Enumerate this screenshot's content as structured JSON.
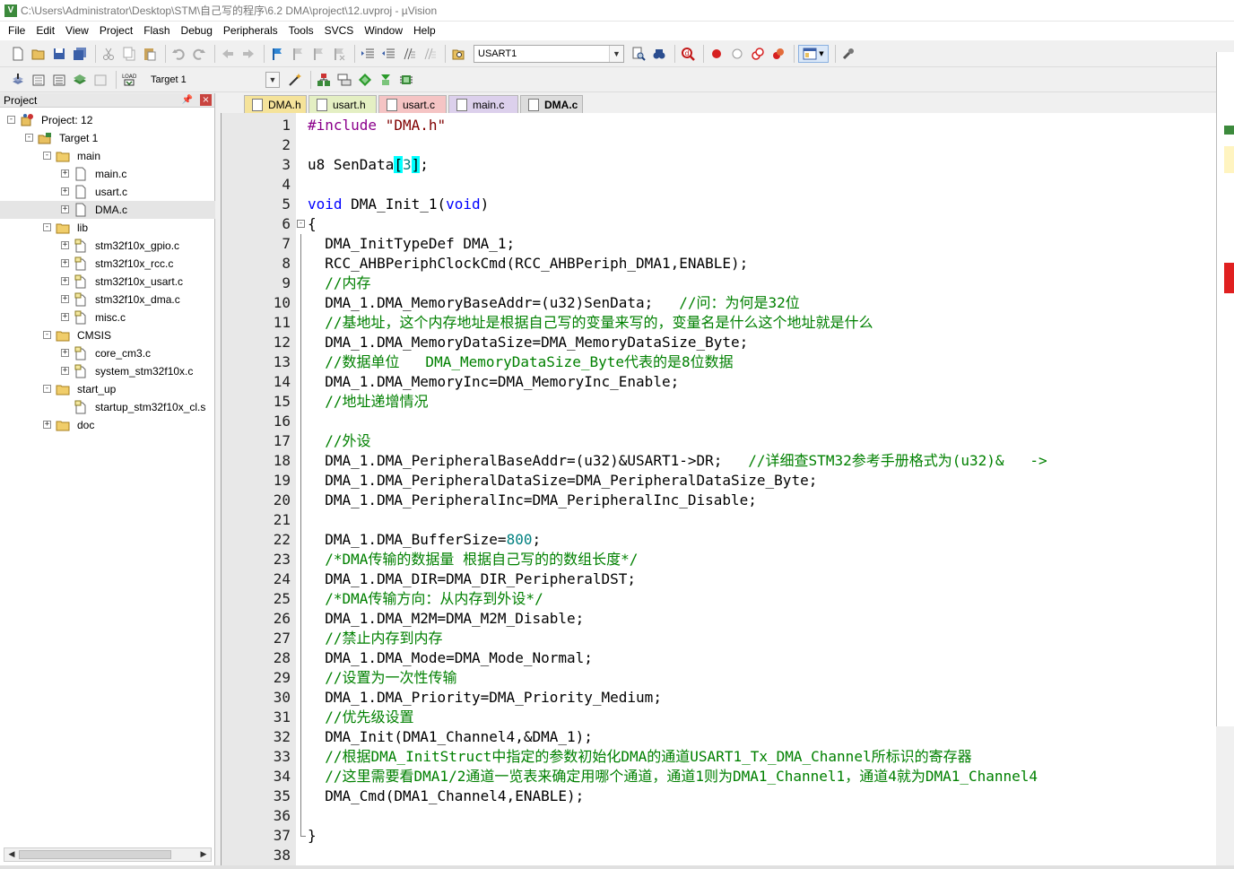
{
  "window": {
    "title": "C:\\Users\\Administrator\\Desktop\\STM\\自己写的程序\\6.2  DMA\\project\\12.uvproj - µVision"
  },
  "menu": [
    "File",
    "Edit",
    "View",
    "Project",
    "Flash",
    "Debug",
    "Peripherals",
    "Tools",
    "SVCS",
    "Window",
    "Help"
  ],
  "toolbar": {
    "search_combo": "USART1",
    "target_combo": "Target 1"
  },
  "project_panel": {
    "title": "Project",
    "tree": [
      {
        "label": "Project: 12",
        "level": 0,
        "type": "project",
        "expander": "−"
      },
      {
        "label": "Target 1",
        "level": 1,
        "type": "target",
        "expander": "−"
      },
      {
        "label": "main",
        "level": 2,
        "type": "folder",
        "expander": "−"
      },
      {
        "label": "main.c",
        "level": 3,
        "type": "file",
        "expander": "+"
      },
      {
        "label": "usart.c",
        "level": 3,
        "type": "file",
        "expander": "+"
      },
      {
        "label": "DMA.c",
        "level": 3,
        "type": "file",
        "expander": "+",
        "selected": true
      },
      {
        "label": "lib",
        "level": 2,
        "type": "folder",
        "expander": "−"
      },
      {
        "label": "stm32f10x_gpio.c",
        "level": 3,
        "type": "libfile",
        "expander": "+"
      },
      {
        "label": "stm32f10x_rcc.c",
        "level": 3,
        "type": "libfile",
        "expander": "+"
      },
      {
        "label": "stm32f10x_usart.c",
        "level": 3,
        "type": "libfile",
        "expander": "+"
      },
      {
        "label": "stm32f10x_dma.c",
        "level": 3,
        "type": "libfile",
        "expander": "+"
      },
      {
        "label": "misc.c",
        "level": 3,
        "type": "libfile",
        "expander": "+"
      },
      {
        "label": "CMSIS",
        "level": 2,
        "type": "folder",
        "expander": "−"
      },
      {
        "label": "core_cm3.c",
        "level": 3,
        "type": "libfile",
        "expander": "+"
      },
      {
        "label": "system_stm32f10x.c",
        "level": 3,
        "type": "libfile",
        "expander": "+"
      },
      {
        "label": "start_up",
        "level": 2,
        "type": "folder",
        "expander": "−"
      },
      {
        "label": "startup_stm32f10x_cl.s",
        "level": 3,
        "type": "libfile",
        "expander": ""
      },
      {
        "label": "doc",
        "level": 2,
        "type": "folder",
        "expander": "+"
      }
    ]
  },
  "tabs": [
    {
      "label": "DMA.h",
      "color": "#f5e39a",
      "active": false
    },
    {
      "label": "usart.h",
      "color": "#e4efc3",
      "active": false
    },
    {
      "label": "usart.c",
      "color": "#f5c4c4",
      "active": false
    },
    {
      "label": "main.c",
      "color": "#dcd0ec",
      "active": false
    },
    {
      "label": "DMA.c",
      "color": "#dcdcdc",
      "active": true
    }
  ],
  "editor": {
    "lines": [
      {
        "n": "1",
        "parts": [
          [
            "pp",
            "#include "
          ],
          [
            "str",
            "\"DMA.h\""
          ]
        ]
      },
      {
        "n": "2",
        "parts": []
      },
      {
        "n": "3",
        "parts": [
          [
            "",
            "u8 SenData"
          ],
          [
            "br",
            "["
          ],
          [
            "num",
            "3"
          ],
          [
            "br",
            "]"
          ],
          [
            "",
            ";"
          ]
        ]
      },
      {
        "n": "4",
        "parts": []
      },
      {
        "n": "5",
        "parts": [
          [
            "kw",
            "void"
          ],
          [
            "",
            " DMA_Init_1("
          ],
          [
            "kw",
            "void"
          ],
          [
            "",
            ")"
          ]
        ]
      },
      {
        "n": "6",
        "parts": [
          [
            "",
            "{"
          ]
        ],
        "fold": "open"
      },
      {
        "n": "7",
        "parts": [
          [
            "",
            "  DMA_InitTypeDef DMA_1;"
          ]
        ],
        "fold": "line"
      },
      {
        "n": "8",
        "parts": [
          [
            "",
            "  RCC_AHBPeriphClockCmd(RCC_AHBPeriph_DMA1,ENABLE);"
          ]
        ],
        "fold": "line"
      },
      {
        "n": "9",
        "parts": [
          [
            "cm",
            "  //内存"
          ]
        ],
        "fold": "line"
      },
      {
        "n": "10",
        "parts": [
          [
            "",
            "  DMA_1.DMA_MemoryBaseAddr=(u32)SenData;   "
          ],
          [
            "cm",
            "//问：为何是32位"
          ]
        ],
        "fold": "line"
      },
      {
        "n": "11",
        "parts": [
          [
            "cm",
            "  //基地址，这个内存地址是根据自己写的变量来写的，变量名是什么这个地址就是什么"
          ]
        ],
        "fold": "line"
      },
      {
        "n": "12",
        "parts": [
          [
            "",
            "  DMA_1.DMA_MemoryDataSize=DMA_MemoryDataSize_Byte;"
          ]
        ],
        "fold": "line"
      },
      {
        "n": "13",
        "parts": [
          [
            "cm",
            "  //数据单位   DMA_MemoryDataSize_Byte代表的是8位数据"
          ]
        ],
        "fold": "line"
      },
      {
        "n": "14",
        "parts": [
          [
            "",
            "  DMA_1.DMA_MemoryInc=DMA_MemoryInc_Enable;"
          ]
        ],
        "fold": "line"
      },
      {
        "n": "15",
        "parts": [
          [
            "cm",
            "  //地址递增情况"
          ]
        ],
        "fold": "line"
      },
      {
        "n": "16",
        "parts": [],
        "fold": "line"
      },
      {
        "n": "17",
        "parts": [
          [
            "cm",
            "  //外设"
          ]
        ],
        "fold": "line"
      },
      {
        "n": "18",
        "parts": [
          [
            "",
            "  DMA_1.DMA_PeripheralBaseAddr=(u32)&USART1->DR;   "
          ],
          [
            "cm",
            "//详细查STM32参考手册格式为(u32)&   ->"
          ]
        ],
        "fold": "line"
      },
      {
        "n": "19",
        "parts": [
          [
            "",
            "  DMA_1.DMA_PeripheralDataSize=DMA_PeripheralDataSize_Byte;"
          ]
        ],
        "fold": "line"
      },
      {
        "n": "20",
        "parts": [
          [
            "",
            "  DMA_1.DMA_PeripheralInc=DMA_PeripheralInc_Disable;"
          ]
        ],
        "fold": "line"
      },
      {
        "n": "21",
        "parts": [],
        "fold": "line"
      },
      {
        "n": "22",
        "parts": [
          [
            "",
            "  DMA_1.DMA_BufferSize="
          ],
          [
            "num",
            "800"
          ],
          [
            "",
            ";"
          ]
        ],
        "fold": "line"
      },
      {
        "n": "23",
        "parts": [
          [
            "cm",
            "  /*DMA传输的数据量 根据自己写的的数组长度*/"
          ]
        ],
        "fold": "line"
      },
      {
        "n": "24",
        "parts": [
          [
            "",
            "  DMA_1.DMA_DIR=DMA_DIR_PeripheralDST;"
          ]
        ],
        "fold": "line"
      },
      {
        "n": "25",
        "parts": [
          [
            "cm",
            "  /*DMA传输方向：从内存到外设*/"
          ]
        ],
        "fold": "line"
      },
      {
        "n": "26",
        "parts": [
          [
            "",
            "  DMA_1.DMA_M2M=DMA_M2M_Disable;"
          ]
        ],
        "fold": "line"
      },
      {
        "n": "27",
        "parts": [
          [
            "cm",
            "  //禁止内存到内存"
          ]
        ],
        "fold": "line"
      },
      {
        "n": "28",
        "parts": [
          [
            "",
            "  DMA_1.DMA_Mode=DMA_Mode_Normal;"
          ]
        ],
        "fold": "line"
      },
      {
        "n": "29",
        "parts": [
          [
            "cm",
            "  //设置为一次性传输"
          ]
        ],
        "fold": "line"
      },
      {
        "n": "30",
        "parts": [
          [
            "",
            "  DMA_1.DMA_Priority=DMA_Priority_Medium;"
          ]
        ],
        "fold": "line"
      },
      {
        "n": "31",
        "parts": [
          [
            "cm",
            "  //优先级设置"
          ]
        ],
        "fold": "line"
      },
      {
        "n": "32",
        "parts": [
          [
            "",
            "  DMA_Init(DMA1_Channel4,&DMA_1);"
          ]
        ],
        "fold": "line"
      },
      {
        "n": "33",
        "parts": [
          [
            "cm",
            "  //根据DMA_InitStruct中指定的参数初始化DMA的通道USART1_Tx_DMA_Channel所标识的寄存器"
          ]
        ],
        "fold": "line"
      },
      {
        "n": "34",
        "parts": [
          [
            "cm",
            "  //这里需要看DMA1/2通道一览表来确定用哪个通道，通道1则为DMA1_Channel1，通道4就为DMA1_Channel4"
          ]
        ],
        "fold": "line"
      },
      {
        "n": "35",
        "parts": [
          [
            "",
            "  DMA_Cmd(DMA1_Channel4,ENABLE);"
          ]
        ],
        "fold": "line"
      },
      {
        "n": "36",
        "parts": [],
        "fold": "line"
      },
      {
        "n": "37",
        "parts": [
          [
            "",
            "}"
          ]
        ],
        "fold": "end"
      },
      {
        "n": "38",
        "parts": []
      }
    ]
  }
}
